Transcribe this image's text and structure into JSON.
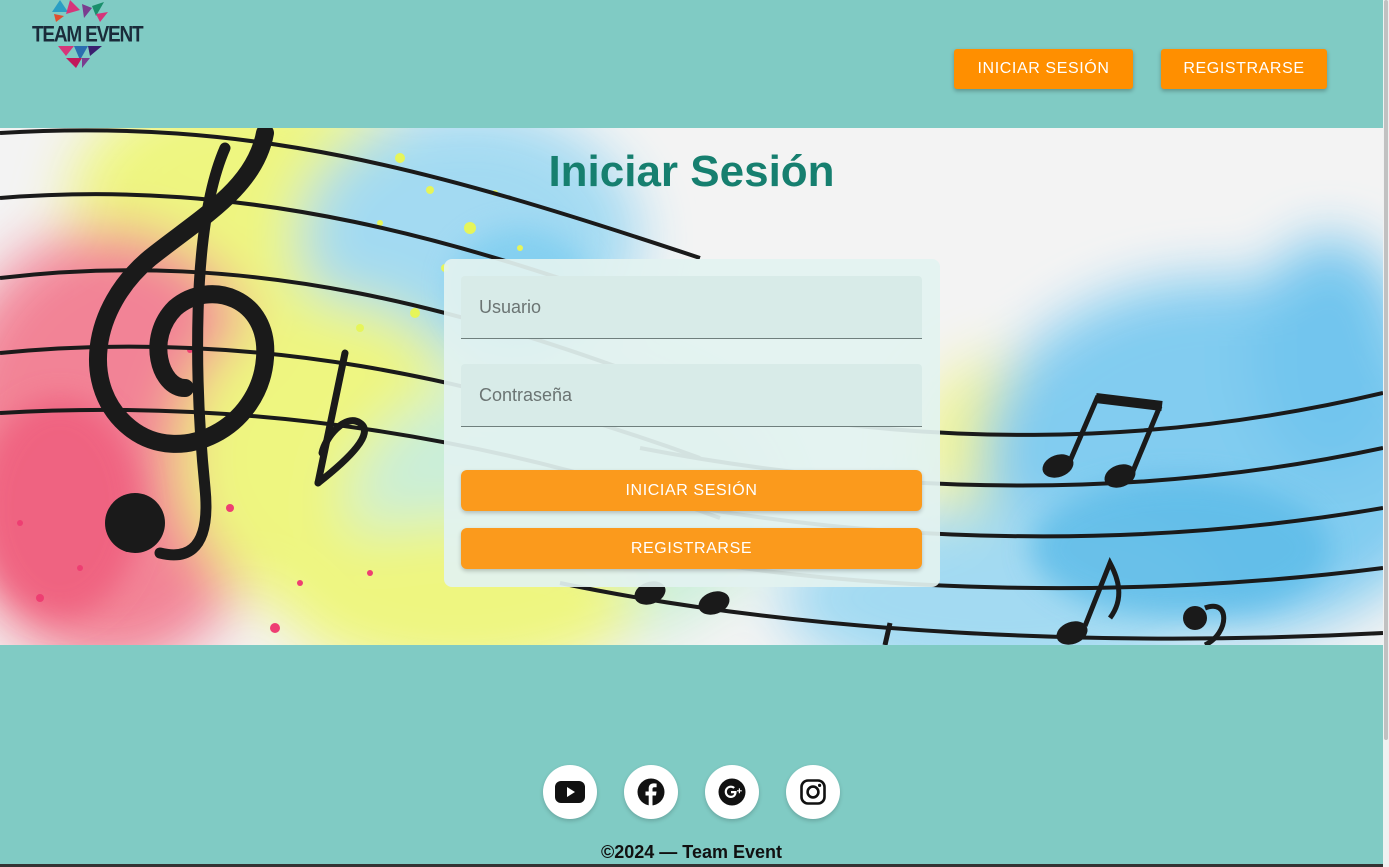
{
  "brand": {
    "name": "TEAM EVENT"
  },
  "nav": {
    "login_label": "INICIAR SESIÓN",
    "register_label": "REGISTRARSE"
  },
  "hero": {
    "title": "Iniciar Sesión"
  },
  "form": {
    "username_placeholder": "Usuario",
    "username_value": "",
    "password_placeholder": "Contraseña",
    "password_value": "",
    "login_label": "INICIAR SESIÓN",
    "register_label": "REGISTRARSE"
  },
  "footer": {
    "socials": [
      {
        "name": "youtube-icon"
      },
      {
        "name": "facebook-icon"
      },
      {
        "name": "google-plus-icon"
      },
      {
        "name": "instagram-icon"
      }
    ],
    "copyright": "©2024 — Team Event"
  },
  "colors": {
    "background": "#80cbc4",
    "accent": "#ff8f00",
    "title": "#167f6f"
  }
}
